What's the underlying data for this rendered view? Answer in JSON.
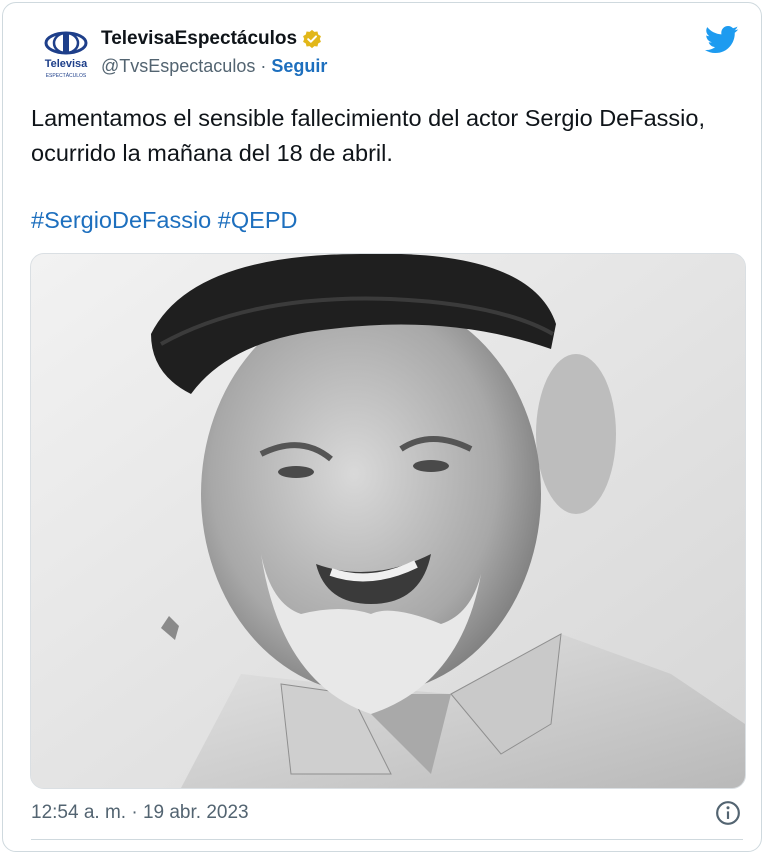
{
  "tweet": {
    "author": {
      "display_name": "TelevisaEspectáculos",
      "handle": "@TvsEspectaculos",
      "separator": "·",
      "follow_label": "Seguir",
      "verified_badge": "gold",
      "logo": {
        "wordmark": "Televisa",
        "subtext": "ESPECTÁCULOS",
        "icon": "televisa-logo"
      }
    },
    "platform_icon": "twitter-bird-icon",
    "text": "Lamentamos el sensible fallecimiento del actor Sergio DeFassio, ocurrido la mañana del 18 de abril.",
    "hashtags": [
      "#SergioDeFassio",
      "#QEPD"
    ],
    "media": {
      "type": "photo",
      "style": "black-and-white portrait"
    },
    "timestamp": "12:54 a. m. · 19 abr. 2023",
    "info_icon": "info-icon"
  },
  "colors": {
    "link": "#1d6fbe",
    "text": "#0f1419",
    "muted": "#536471",
    "twitter_blue": "#1d9bf0",
    "verified_gold": "#e2b719",
    "border": "#cfd9de"
  }
}
